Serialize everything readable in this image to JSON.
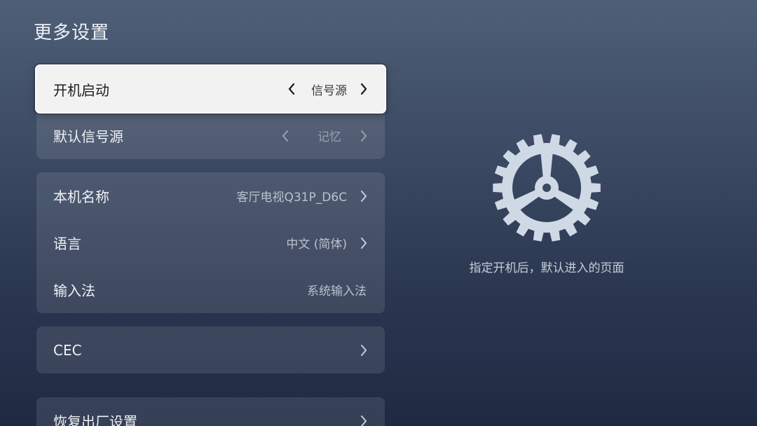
{
  "page": {
    "title": "更多设置",
    "hint": "指定开机后，默认进入的页面"
  },
  "groups": [
    {
      "rows": [
        {
          "label": "开机启动",
          "value": "信号源",
          "left_arrow": true,
          "right_arrow": true,
          "focused": true
        },
        {
          "label": "默认信号源",
          "value": "记忆",
          "left_arrow": true,
          "right_arrow": true,
          "focused": false
        }
      ]
    },
    {
      "rows": [
        {
          "label": "本机名称",
          "value": "客厅电视Q31P_D6C",
          "left_arrow": false,
          "right_arrow": true,
          "focused": false
        },
        {
          "label": "语言",
          "value": "中文 (简体)",
          "left_arrow": false,
          "right_arrow": true,
          "focused": false
        },
        {
          "label": "输入法",
          "value": "系统输入法",
          "left_arrow": false,
          "right_arrow": false,
          "focused": false
        }
      ]
    },
    {
      "rows": [
        {
          "label": "CEC",
          "value": "",
          "left_arrow": false,
          "right_arrow": true,
          "focused": false
        }
      ]
    },
    {
      "rows": [
        {
          "label": "恢复出厂设置",
          "value": "",
          "left_arrow": false,
          "right_arrow": true,
          "focused": false
        }
      ]
    }
  ],
  "icons": {
    "hero": "gear-icon",
    "left": "chevron-left-icon",
    "right": "chevron-right-icon"
  },
  "colors": {
    "focus_bg": "#f2f2f2",
    "gear": "#cfd9e6"
  }
}
